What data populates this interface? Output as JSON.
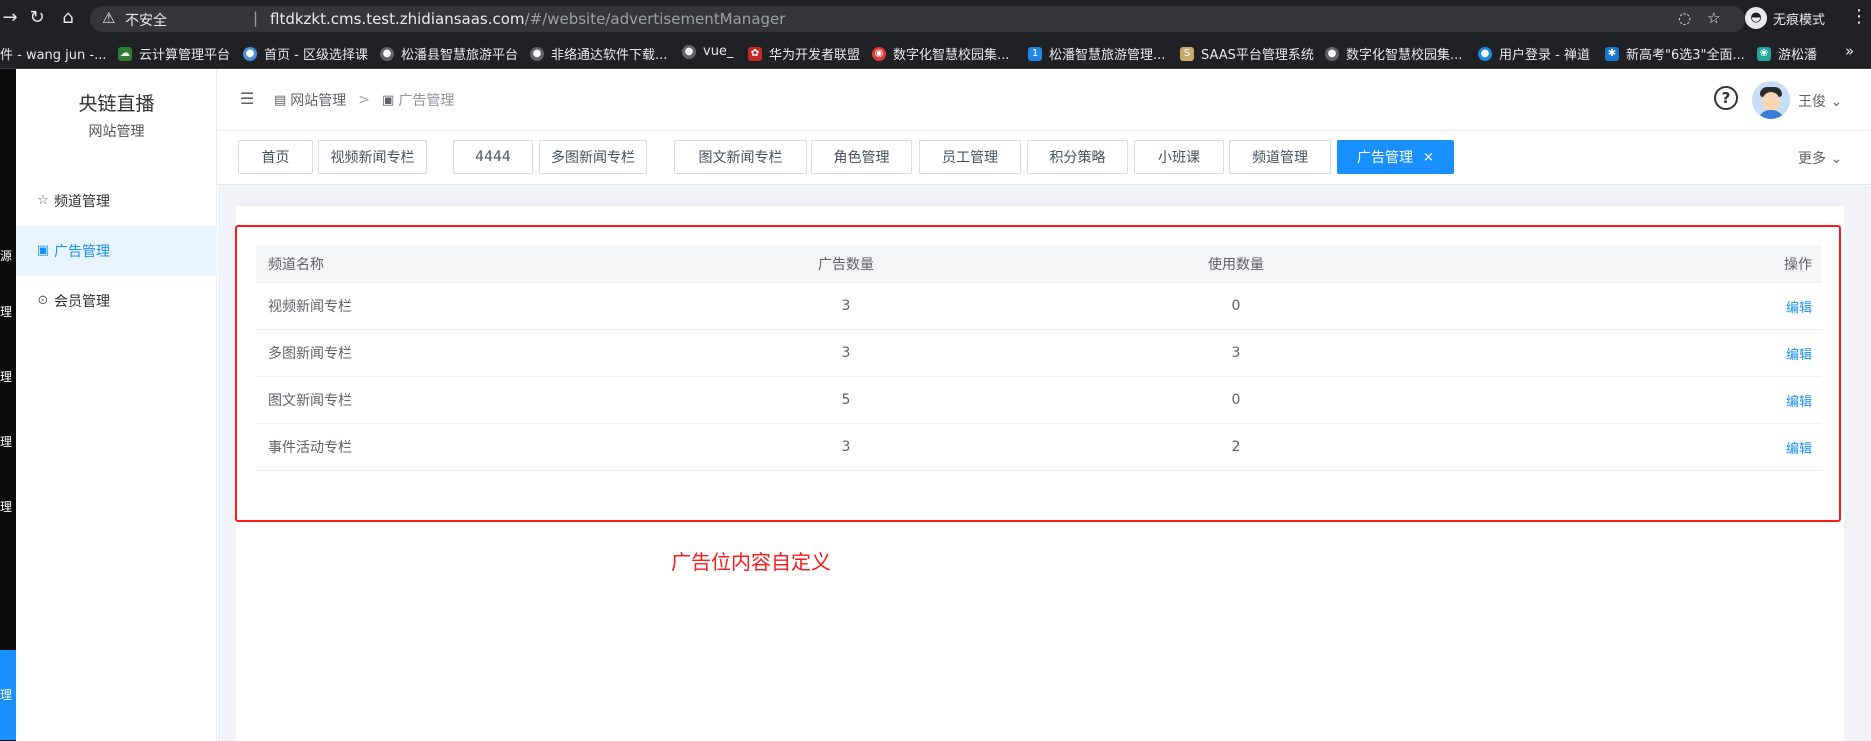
{
  "browser": {
    "security_label": "不安全",
    "url_host": "fltdkzkt.cms.test.zhidiansaas.com",
    "url_path": "/#/website/advertisementManager",
    "profile_label": "无痕模式",
    "bookmarks": [
      {
        "label": "件 - wang jun -...",
        "color": "#202124"
      },
      {
        "label": "云计算管理平台",
        "color": "#2e7d32"
      },
      {
        "label": "首页 - 区级选择课",
        "color": "#4a90d9"
      },
      {
        "label": "松潘县智慧旅游平台",
        "color": "#5f6368"
      },
      {
        "label": "非络通达软件下载...",
        "color": "#5f6368"
      },
      {
        "label": "vue_",
        "color": "#5f6368"
      },
      {
        "label": "华为开发者联盟",
        "color": "#c62828"
      },
      {
        "label": "数字化智慧校园集...",
        "color": "#e53935"
      },
      {
        "label": "松潘智慧旅游管理...",
        "color": "#1e88e5"
      },
      {
        "label": "SAAS平台管理系统",
        "color": "#c8a96e"
      },
      {
        "label": "数字化智慧校园集...",
        "color": "#5f6368"
      },
      {
        "label": "用户登录 - 禅道",
        "color": "#1e88e5"
      },
      {
        "label": "新高考\"6选3\"全面...",
        "color": "#1976d2"
      },
      {
        "label": "游松潘",
        "color": "#26a69a"
      }
    ]
  },
  "left_strip_chars": [
    "源",
    "理",
    "理",
    "理",
    "理",
    "理"
  ],
  "sidebar": {
    "title": "央链直播",
    "subtitle": "网站管理",
    "items": [
      {
        "label": "频道管理",
        "icon": "star-icon",
        "active": false
      },
      {
        "label": "广告管理",
        "icon": "image-icon",
        "active": true
      },
      {
        "label": "会员管理",
        "icon": "play-circle-icon",
        "active": false
      }
    ]
  },
  "header": {
    "breadcrumb_parent": "网站管理",
    "breadcrumb_current": "广告管理",
    "help": "?",
    "user_name": "王俊"
  },
  "tags": {
    "items": [
      "首页",
      "视频新闻专栏",
      "4444",
      "多图新闻专栏",
      "图文新闻专栏",
      "角色管理",
      "员工管理",
      "积分策略",
      "小班课",
      "频道管理",
      "广告管理"
    ],
    "active_index": 10,
    "more_label": "更多"
  },
  "table": {
    "headers": [
      "频道名称",
      "广告数量",
      "使用数量",
      "操作"
    ],
    "rows": [
      {
        "name": "视频新闻专栏",
        "ad_count": "3",
        "use_count": "0",
        "action": "编辑"
      },
      {
        "name": "多图新闻专栏",
        "ad_count": "3",
        "use_count": "3",
        "action": "编辑"
      },
      {
        "name": "图文新闻专栏",
        "ad_count": "5",
        "use_count": "0",
        "action": "编辑"
      },
      {
        "name": "事件活动专栏",
        "ad_count": "3",
        "use_count": "2",
        "action": "编辑"
      }
    ]
  },
  "annotation": {
    "text": "广告位内容自定义",
    "color": "#ff1a1a"
  },
  "colors": {
    "accent": "#1890ff",
    "annotation": "#ff1a1a"
  }
}
